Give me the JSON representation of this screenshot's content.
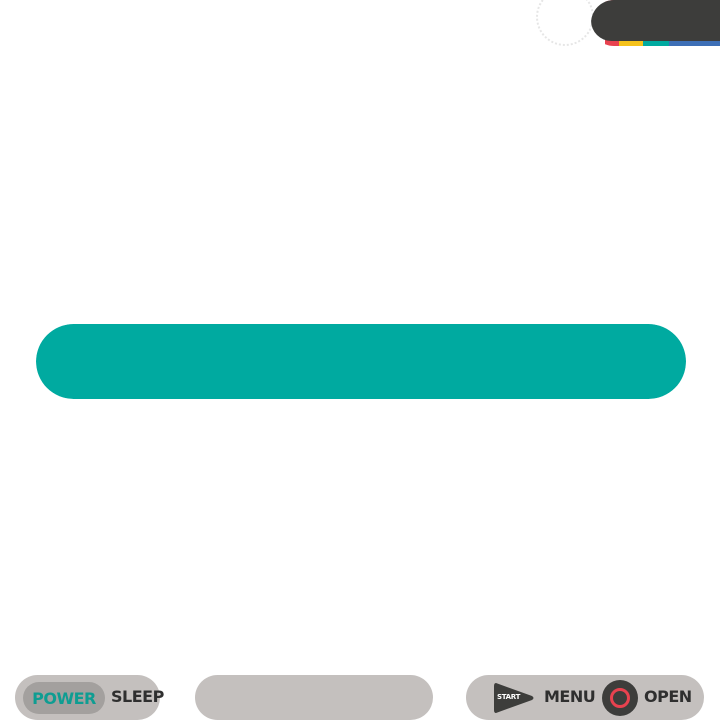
{
  "colors": {
    "accent": "#00aaa0",
    "dark": "#3d3d3b",
    "pill_gray": "#c4c0be",
    "stripes": [
      "#e8424f",
      "#f5c21b",
      "#00aaa0",
      "#3d6fb6"
    ]
  },
  "status_pill": {
    "icon": "rainbow-status-stripes"
  },
  "progress": {
    "value": 1.0
  },
  "controls": {
    "power_label": "POWER",
    "sleep_label": "SLEEP",
    "start_label": "START",
    "menu_label": "MENU",
    "open_label": "OPEN",
    "start_icon": "play-triangle-icon",
    "open_icon": "circle-icon"
  }
}
